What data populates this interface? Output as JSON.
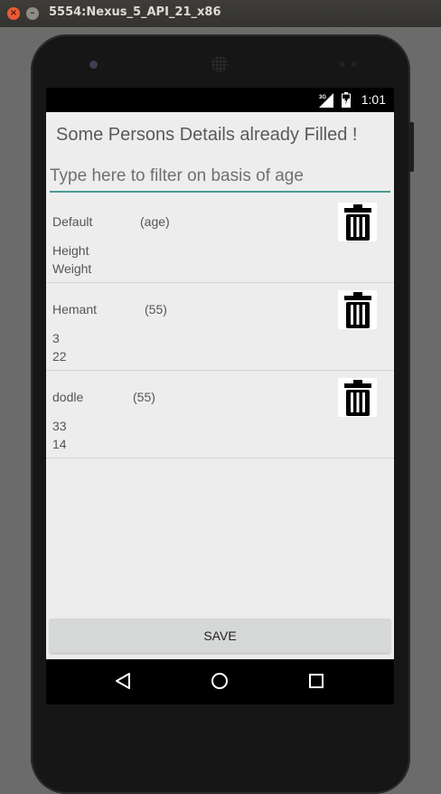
{
  "window": {
    "title": "5554:Nexus_5_API_21_x86",
    "close_glyph": "×",
    "minimize_glyph": "–"
  },
  "status_bar": {
    "signal_label": "3G",
    "time": "1:01"
  },
  "app": {
    "title": "Some Persons Details already Filled !",
    "filter_placeholder": "Type here to filter on basis of age",
    "save_label": "SAVE"
  },
  "persons": [
    {
      "name": "Default",
      "age": "(age)",
      "height": "Height",
      "weight": "Weight"
    },
    {
      "name": "Hemant",
      "age": "(55)",
      "height": "3",
      "weight": "22"
    },
    {
      "name": "dodle",
      "age": "(55)",
      "height": "33",
      "weight": "14"
    }
  ],
  "icons": {
    "delete": "trash-icon",
    "nav_back": "back-triangle-icon",
    "nav_home": "home-circle-icon",
    "nav_recents": "recents-square-icon"
  },
  "colors": {
    "accent_underline": "#4a9b95",
    "screen_bg": "#ededed",
    "save_button": "#d6d7d7"
  }
}
